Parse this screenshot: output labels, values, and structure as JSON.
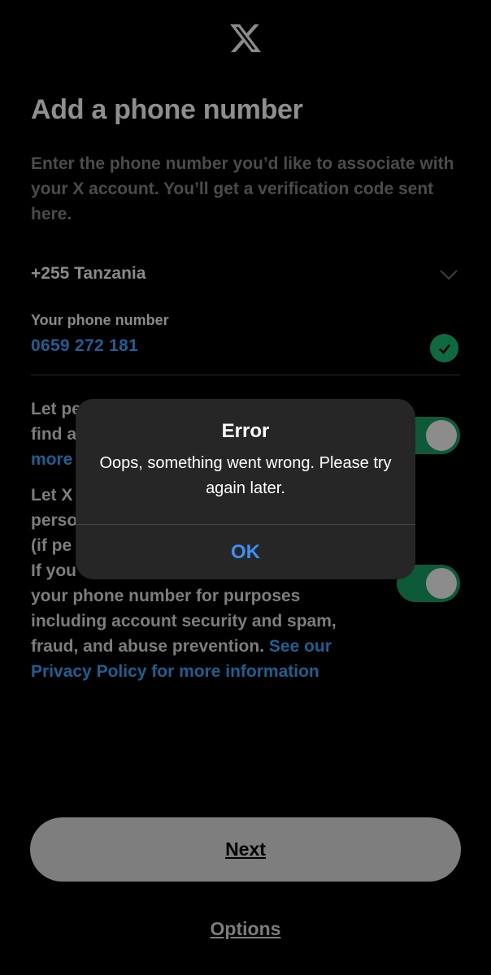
{
  "header": {
    "logo_icon": "x-logo-icon"
  },
  "page": {
    "title": "Add a phone number",
    "subtitle": "Enter the phone number you’d like to associate with your X account. You’ll get a verification code sent here."
  },
  "country_select": {
    "value": "+255 Tanzania",
    "icon": "chevron-down-icon"
  },
  "phone_field": {
    "label": "Your phone number",
    "value": "0659 272 181",
    "status_icon": "check-circle-icon"
  },
  "preferences": {
    "discover": {
      "line1": "Let pe",
      "line2": "find a",
      "line3_link": "more",
      "enabled": true
    },
    "personalize": {
      "line1": "Let X",
      "line2": "perso",
      "line3": "(if pe",
      "line4": "If you",
      "line5": "your phone number for purposes",
      "line6": "including account security and spam,",
      "line7_text": "fraud, and abuse prevention. ",
      "line7_link": "See our",
      "line8_link": "Privacy Policy for more information",
      "enabled": true
    }
  },
  "actions": {
    "next_label": "Next",
    "options_label": "Options"
  },
  "alert": {
    "title": "Error",
    "message": "Oops, something went wrong. Please try again later.",
    "ok_label": "OK"
  },
  "colors": {
    "background": "#000000",
    "link_blue": "#1d5f93",
    "toggle_on": "#0c5a37",
    "alert_ok": "#3d8ff0",
    "alert_bg": "#262626"
  }
}
